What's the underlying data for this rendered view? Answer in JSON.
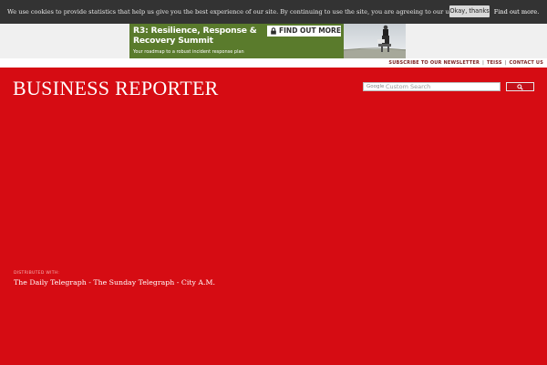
{
  "cookie_bar": {
    "message": "We use cookies to provide statistics that help us give you the best experience of our site. By continuing to use the site, you are agreeing to our use of cookies.",
    "more_link": "Find out more.",
    "accept_label": "Okay, thanks"
  },
  "ad": {
    "title": "R3: Resilience, Response & Recovery Summit",
    "subtitle": "Your roadmap to a robust incident response plan",
    "cta": "FIND OUT MORE",
    "colors": {
      "background": "#5a7b2c",
      "cta_bg": "#ffffff"
    }
  },
  "topnav": {
    "links": [
      "SUBSCRIBE TO OUR NEWSLETTER",
      "TEISS",
      "CONTACT US"
    ]
  },
  "header": {
    "logo": "BUSINESS REPORTER"
  },
  "search": {
    "brand": "Google",
    "placeholder": "Custom Search",
    "button_icon": "search-icon"
  },
  "distribution": {
    "label": "DISTRIBUTED WITH:",
    "papers": "The Daily Telegraph - The Sunday Telegraph - City A.M."
  },
  "colors": {
    "page_background": "#d60c13",
    "cookie_bar": "#333333",
    "nav_link": "#7a1f1f"
  }
}
